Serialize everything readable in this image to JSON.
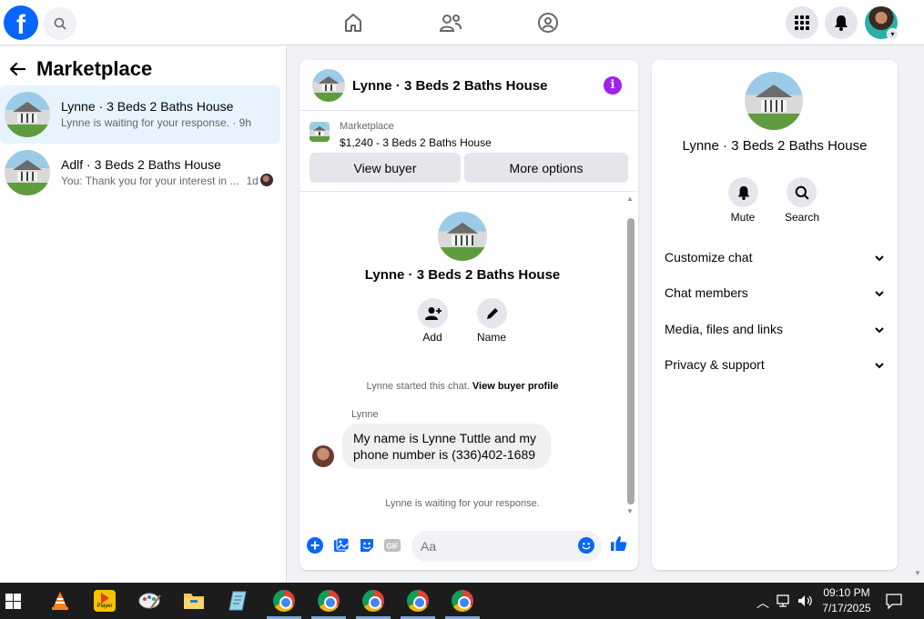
{
  "top_nav": {
    "logo": "f",
    "icons": [
      "search-icon",
      "home-icon",
      "friends-icon",
      "groups-icon",
      "menu-grid-icon",
      "bell-icon",
      "profile-avatar"
    ]
  },
  "sidebar": {
    "title": "Marketplace",
    "conversations": [
      {
        "title": "Lynne · 3 Beds 2 Baths House",
        "subtitle": "Lynne is waiting for your response. · 9h",
        "active": true
      },
      {
        "title": "Adlf · 3 Beds 2 Baths House",
        "subtitle": "You: Thank you for your interest in ...",
        "time": "1d",
        "active": false
      }
    ]
  },
  "chat": {
    "title": "Lynne · 3 Beds 2 Baths House",
    "listing_label": "Marketplace",
    "listing_price": "$1,240 - 3 Beds 2 Baths House",
    "view_buyer": "View buyer",
    "more_options": "More options",
    "center_title": "Lynne · 3 Beds 2 Baths House",
    "actions": {
      "add": "Add",
      "name": "Name"
    },
    "started_text": "Lynne started this chat.",
    "view_profile": "View buyer profile",
    "sender": "Lynne",
    "message_line1": "My name is Lynne Tuttle and my",
    "message_line2": "phone number is (336)402-1689",
    "waiting": "Lynne is waiting for your response.",
    "input_placeholder": "Aa",
    "gif_label": "GIF"
  },
  "details": {
    "title": "Lynne · 3 Beds 2 Baths House",
    "mute": "Mute",
    "search": "Search",
    "sections": [
      "Customize chat",
      "Chat members",
      "Media, files and links",
      "Privacy & support"
    ]
  },
  "taskbar": {
    "apps": [
      "windows-start",
      "vlc",
      "player",
      "paint",
      "file-explorer",
      "notepad",
      "chrome",
      "chrome",
      "chrome",
      "chrome",
      "chrome"
    ],
    "player_label": "Player",
    "time": "09:10 PM",
    "date": "7/17/2025"
  },
  "colors": {
    "brand": "#0866ff",
    "info": "#a020f0",
    "active_row": "#e7f3ff"
  }
}
